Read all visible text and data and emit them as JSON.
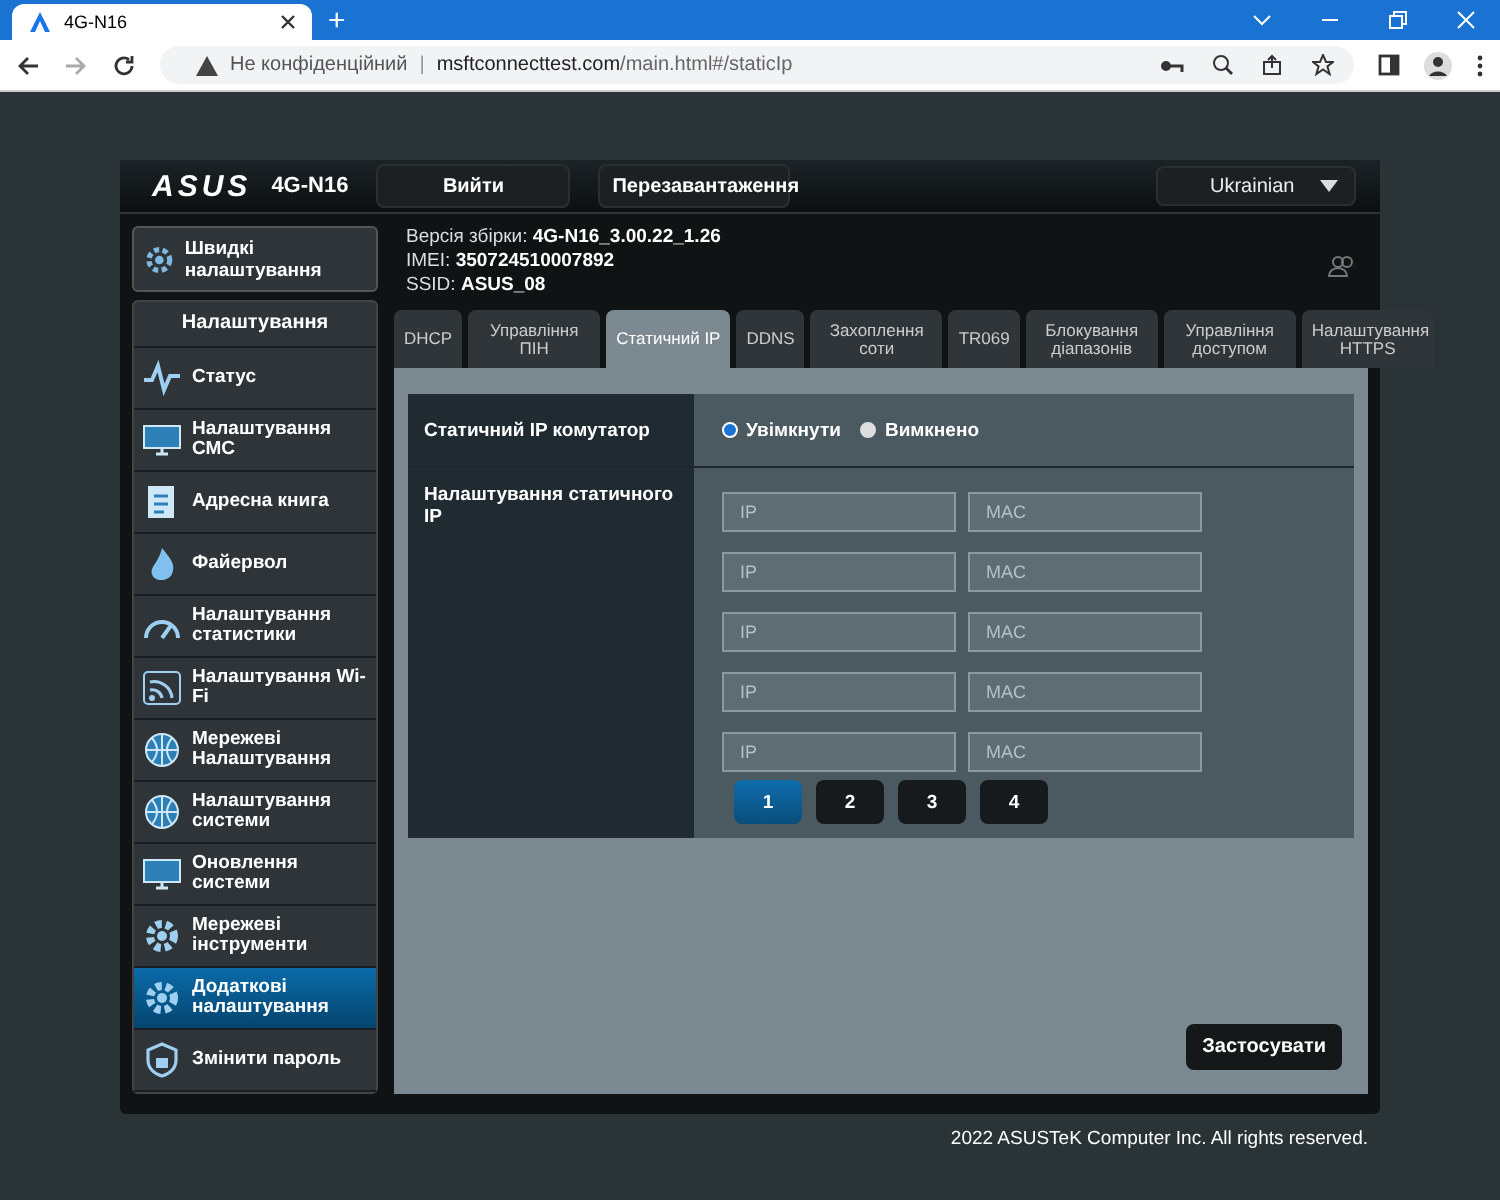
{
  "browser": {
    "tab_title": "4G-N16",
    "new_tab": "+",
    "security": "Не конфіденційний",
    "separator": "|",
    "url_host": "msftconnecttest.com",
    "url_path": "/main.html#/staticIp"
  },
  "header": {
    "logo": "ASUS",
    "model": "4G-N16",
    "buttons": [
      "Вийти",
      "Перезавантаження"
    ],
    "language": "Ukrainian"
  },
  "info": [
    {
      "label": "Версія збірки:",
      "value": "4G-N16_3.00.22_1.26"
    },
    {
      "label": "IMEI:",
      "value": "350724510007892"
    },
    {
      "label": "SSID:",
      "value": "ASUS_08"
    }
  ],
  "quick_setup": "Швидкі налаштування",
  "sidebar": {
    "title": "Налаштування",
    "items": [
      {
        "label": "Статус",
        "selected": false
      },
      {
        "label": "Налаштування СМС",
        "selected": false
      },
      {
        "label": "Адресна книга",
        "selected": false
      },
      {
        "label": "Файервол",
        "selected": false
      },
      {
        "label": "Налаштування статистики",
        "selected": false
      },
      {
        "label": "Налаштування Wi-Fi",
        "selected": false
      },
      {
        "label": "Мережеві Налаштування",
        "selected": false
      },
      {
        "label": "Налаштування системи",
        "selected": false
      },
      {
        "label": "Оновлення системи",
        "selected": false
      },
      {
        "label": "Мережеві інструменти",
        "selected": false
      },
      {
        "label": "Додаткові налаштування",
        "selected": true
      },
      {
        "label": "Змінити пароль",
        "selected": false
      }
    ]
  },
  "tabs": [
    {
      "label": "DHCP",
      "selected": false
    },
    {
      "label": "Управління ПІН",
      "selected": false
    },
    {
      "label": "Статичний IP",
      "selected": true
    },
    {
      "label": "DDNS",
      "selected": false
    },
    {
      "label": "Захоплення соти",
      "selected": false
    },
    {
      "label": "TR069",
      "selected": false
    },
    {
      "label": "Блокування діапазонів",
      "selected": false
    },
    {
      "label": "Управління доступом",
      "selected": false
    },
    {
      "label": "Налаштування HTTPS",
      "selected": false
    }
  ],
  "switch_row": {
    "label": "Статичний IP комутатор",
    "options": [
      {
        "label": "Увімкнути",
        "selected": true
      },
      {
        "label": "Вимкнено",
        "selected": false
      }
    ]
  },
  "static_row": {
    "label": "Налаштування статичного IP",
    "entries": [
      {
        "ip_placeholder": "IP",
        "mac_placeholder": "MAC"
      },
      {
        "ip_placeholder": "IP",
        "mac_placeholder": "MAC"
      },
      {
        "ip_placeholder": "IP",
        "mac_placeholder": "MAC"
      },
      {
        "ip_placeholder": "IP",
        "mac_placeholder": "MAC"
      },
      {
        "ip_placeholder": "IP",
        "mac_placeholder": "MAC"
      }
    ],
    "pages": [
      {
        "label": "1",
        "selected": true
      },
      {
        "label": "2",
        "selected": false
      },
      {
        "label": "3",
        "selected": false
      },
      {
        "label": "4",
        "selected": false
      }
    ]
  },
  "apply": "Застосувати",
  "footer": "2022 ASUSTeK Computer Inc. All rights reserved."
}
